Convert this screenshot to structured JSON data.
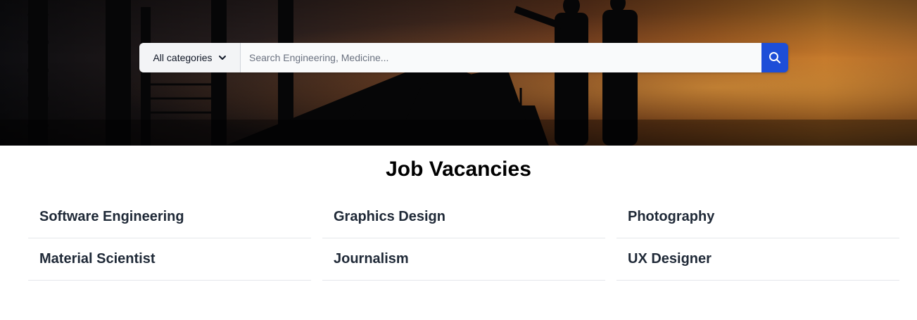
{
  "search": {
    "category_label": "All categories",
    "placeholder": "Search Engineering, Medicine..."
  },
  "section": {
    "title": "Job Vacancies"
  },
  "jobs": [
    {
      "label": "Software Engineering"
    },
    {
      "label": "Graphics Design"
    },
    {
      "label": "Photography"
    },
    {
      "label": "Material Scientist"
    },
    {
      "label": "Journalism"
    },
    {
      "label": "UX Designer"
    }
  ],
  "colors": {
    "accent": "#1d4ed8"
  },
  "icons": {
    "category_toggle": "chevron-down-icon",
    "search_button": "search-icon"
  }
}
